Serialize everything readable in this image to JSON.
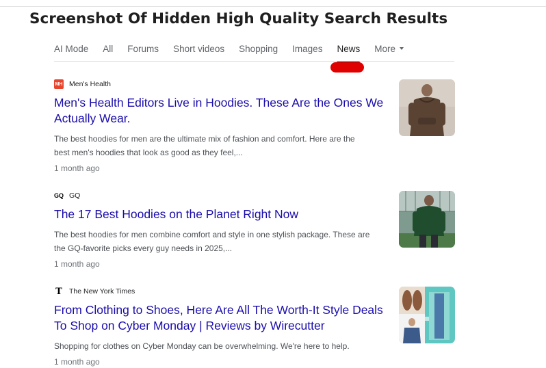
{
  "heading": "Screenshot Of  Hidden High Quality Search Results",
  "tabs": [
    {
      "label": "AI Mode"
    },
    {
      "label": "All"
    },
    {
      "label": "Forums"
    },
    {
      "label": "Short videos"
    },
    {
      "label": "Shopping"
    },
    {
      "label": "Images"
    },
    {
      "label": "News",
      "active": true
    },
    {
      "label": "More"
    }
  ],
  "annotation_color": "#e00000",
  "results": [
    {
      "source": "Men's Health",
      "favicon_text": "MH",
      "title_line1": "Men's Health Editors Live in Hoodies. These Are the Ones We",
      "title_line2": "Actually Wear.",
      "snippet_line1": "The best hoodies for men are the ultimate mix of fashion and comfort. Here are the",
      "snippet_line2": "best men's hoodies that look as good as they feel,...",
      "date": "1 month ago",
      "thumbnail": "man-in-brown-hoodie-image"
    },
    {
      "source": "GQ",
      "favicon_text": "GQ",
      "title_line1": "The 17 Best Hoodies on the Planet Right Now",
      "snippet_line1": "The best hoodies for men combine comfort and style in one stylish package. These are",
      "snippet_line2": "the GQ-favorite picks every guy needs in 2025,...",
      "date": "1 month ago",
      "thumbnail": "man-in-green-hoodie-image"
    },
    {
      "source": "The New York Times",
      "favicon_text": "T",
      "title_line1": "From Clothing to Shoes, Here Are All The Worth-It Style Deals",
      "title_line2": "To Shop on Cyber Monday | Reviews by Wirecutter",
      "snippet_line1": "Shopping for clothes on Cyber Monday can be overwhelming. We're here to help.",
      "date": "1 month ago",
      "thumbnail": "shoes-and-clothing-collage-image"
    }
  ]
}
